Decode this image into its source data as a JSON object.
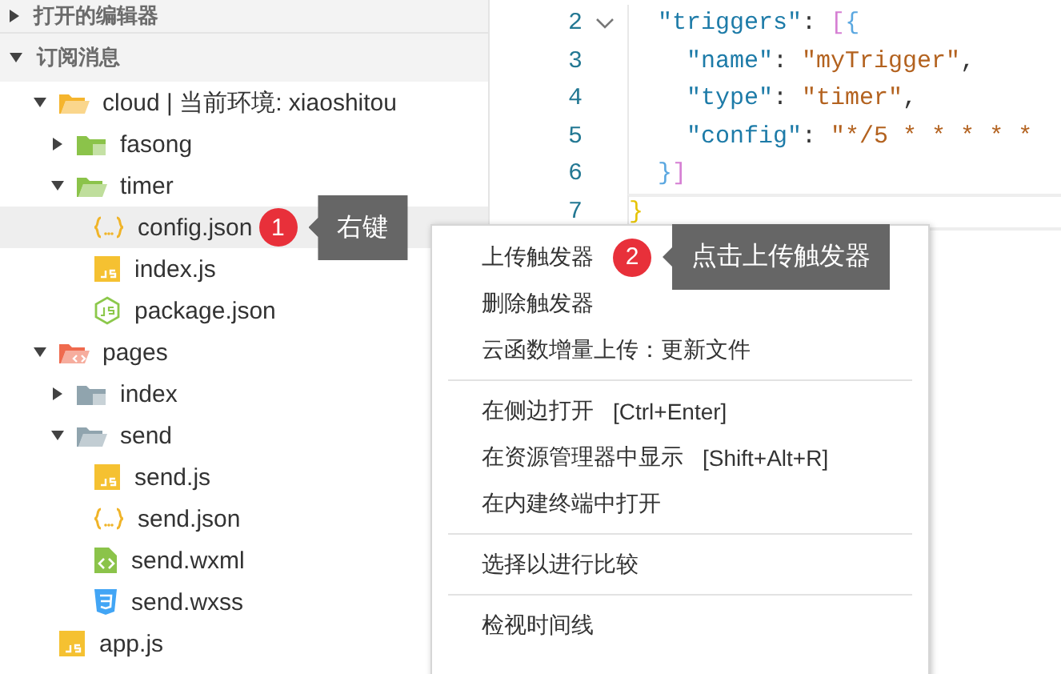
{
  "sidebar": {
    "sections": [
      {
        "title": "打开的编辑器",
        "expanded": false
      },
      {
        "title": "订阅消息",
        "expanded": true
      }
    ],
    "tree": [
      {
        "label": "cloud | 当前环境: xiaoshitou",
        "kind": "cloud-folder",
        "expanded": true,
        "selected": false,
        "children": [
          {
            "label": "fasong",
            "kind": "function-folder",
            "expanded": false,
            "selected": false
          },
          {
            "label": "timer",
            "kind": "function-folder",
            "expanded": true,
            "selected": false,
            "children": [
              {
                "label": "config.json",
                "kind": "json",
                "selected": true,
                "callout": {
                  "number": "1",
                  "text": "右键"
                }
              },
              {
                "label": "index.js",
                "kind": "js",
                "selected": false
              },
              {
                "label": "package.json",
                "kind": "node",
                "selected": false
              }
            ]
          }
        ]
      },
      {
        "label": "pages",
        "kind": "pages-folder",
        "expanded": true,
        "selected": false,
        "children": [
          {
            "label": "index",
            "kind": "folder",
            "expanded": false,
            "selected": false
          },
          {
            "label": "send",
            "kind": "folder",
            "expanded": true,
            "selected": false,
            "children": [
              {
                "label": "send.js",
                "kind": "js",
                "selected": false
              },
              {
                "label": "send.json",
                "kind": "json",
                "selected": false
              },
              {
                "label": "send.wxml",
                "kind": "wxml",
                "selected": false
              },
              {
                "label": "send.wxss",
                "kind": "wxss",
                "selected": false
              }
            ]
          }
        ]
      },
      {
        "label": "app.js",
        "kind": "js",
        "selected": false
      }
    ]
  },
  "editor": {
    "lines": [
      {
        "number": "2",
        "foldable": true,
        "current": false,
        "tokens": [
          {
            "kind": "key",
            "text": "  \"triggers\""
          },
          {
            "kind": "punct",
            "text": ": "
          },
          {
            "kind": "bracket-2",
            "text": "["
          },
          {
            "kind": "bracket-3",
            "text": "{"
          }
        ]
      },
      {
        "number": "3",
        "foldable": false,
        "current": false,
        "tokens": [
          {
            "kind": "key",
            "text": "    \"name\""
          },
          {
            "kind": "punct",
            "text": ": "
          },
          {
            "kind": "string",
            "text": "\"myTrigger\""
          },
          {
            "kind": "punct",
            "text": ","
          }
        ]
      },
      {
        "number": "4",
        "foldable": false,
        "current": false,
        "tokens": [
          {
            "kind": "key",
            "text": "    \"type\""
          },
          {
            "kind": "punct",
            "text": ": "
          },
          {
            "kind": "string",
            "text": "\"timer\""
          },
          {
            "kind": "punct",
            "text": ","
          }
        ]
      },
      {
        "number": "5",
        "foldable": false,
        "current": false,
        "tokens": [
          {
            "kind": "key",
            "text": "    \"config\""
          },
          {
            "kind": "punct",
            "text": ": "
          },
          {
            "kind": "string",
            "text": "\"*/5 * * * * *"
          }
        ]
      },
      {
        "number": "6",
        "foldable": false,
        "current": false,
        "tokens": [
          {
            "kind": "bracket-3",
            "text": "  }"
          },
          {
            "kind": "bracket-2",
            "text": "]"
          }
        ]
      },
      {
        "number": "7",
        "foldable": false,
        "current": true,
        "tokens": [
          {
            "kind": "bracket-1",
            "text": "}"
          }
        ]
      }
    ]
  },
  "context_menu": {
    "groups": [
      [
        {
          "label": "上传触发器",
          "callout": {
            "number": "2",
            "text": "点击上传触发器"
          }
        },
        {
          "label": "删除触发器"
        },
        {
          "label": "云函数增量上传：更新文件"
        }
      ],
      [
        {
          "label": "在侧边打开",
          "shortcut": "[Ctrl+Enter]"
        },
        {
          "label": "在资源管理器中显示",
          "shortcut": "[Shift+Alt+R]"
        },
        {
          "label": "在内建终端中打开"
        }
      ],
      [
        {
          "label": "选择以进行比较"
        }
      ],
      [
        {
          "label": "检视时间线"
        }
      ]
    ]
  }
}
